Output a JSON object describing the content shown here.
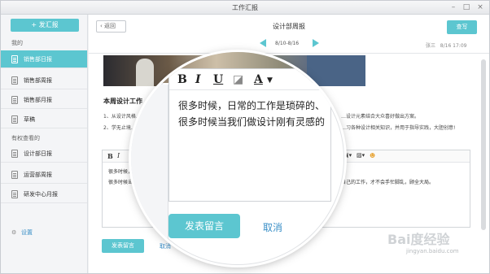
{
  "window": {
    "title": "工作汇报"
  },
  "sidebar": {
    "new_button": "+ 发汇报",
    "section_mine": "我的",
    "mine_items": [
      {
        "label": "销售部日报",
        "active": true
      },
      {
        "label": "销售部周报",
        "active": false
      },
      {
        "label": "销售部月报",
        "active": false
      },
      {
        "label": "草稿",
        "active": false
      }
    ],
    "section_view": "有权查看的",
    "view_items": [
      {
        "label": "设计部日报"
      },
      {
        "label": "运营部周报"
      },
      {
        "label": "研发中心月报"
      }
    ],
    "settings": "设置"
  },
  "header": {
    "back": "返回",
    "title": "设计部周报",
    "action": "查写",
    "date_range": "8/10-8/16",
    "author": "张三",
    "timestamp": "8/16 17:09"
  },
  "report": {
    "section_title": "本周设计工作",
    "line1": "1、从设计风格…",
    "line1_tail": "…设计元素结合大众喜好做出方案。",
    "line2": "2、学无止境…",
    "line2_tail": "…习各种设计相关知识，并用于指导实践，大胆创意!"
  },
  "editor": {
    "toolbar": [
      "B",
      "I",
      "U"
    ],
    "text1": "很多时候，",
    "text1_tail": "",
    "text2": "很多时候当…",
    "text2_tail": "…自己的工作，才不会手忙脚乱，顾全大局。",
    "publish": "发表留言",
    "cancel": "取消"
  },
  "magnifier": {
    "toolbar": [
      "B",
      "I",
      "U",
      "A"
    ],
    "text1": "很多时候，日常的工作是琐碎的、",
    "text2": "很多时候当我们做设计刚有灵感的",
    "publish": "发表留言",
    "cancel": "取消"
  },
  "watermark": {
    "main": "Bai度经验",
    "sub": "jingyan.baidu.com"
  },
  "colors": {
    "accent": "#5cc6d0",
    "link": "#3a8fc7"
  }
}
